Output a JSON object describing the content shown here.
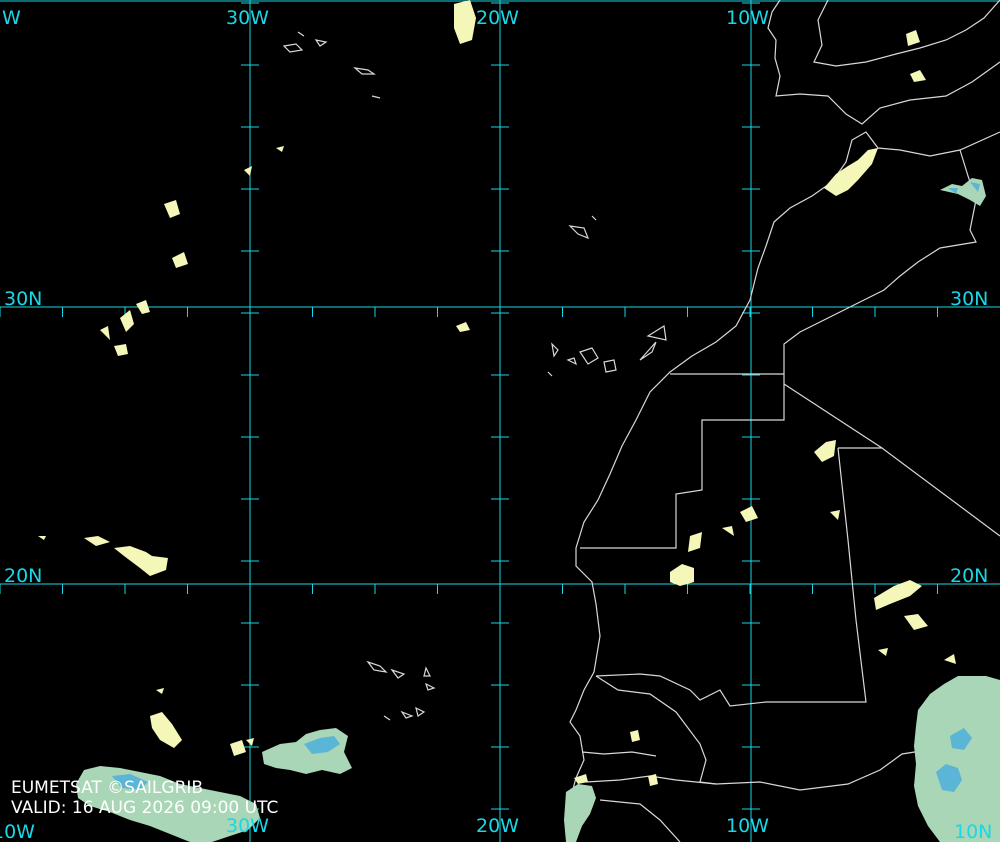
{
  "map": {
    "lon_labels_top": [
      "W",
      "30W",
      "20W",
      "10W"
    ],
    "lon_labels_bottom": [
      "10W",
      "30W",
      "20W",
      "10W",
      "10N"
    ],
    "lat_labels_left": [
      "30N",
      "20N"
    ],
    "lat_labels_right": [
      "30N",
      "20N"
    ],
    "colors": {
      "background": "#000000",
      "grid": "#19d7e6",
      "coastline": "#d8d8d8",
      "cloud_low": "#f5f7b8",
      "cloud_mid": "#a9d6b6",
      "cloud_high": "#5bb5d6"
    }
  },
  "credit": {
    "source": "EUMETSAT ©SAILGRIB",
    "valid": "VALID:  16 AUG 2026 09:00 UTC"
  }
}
